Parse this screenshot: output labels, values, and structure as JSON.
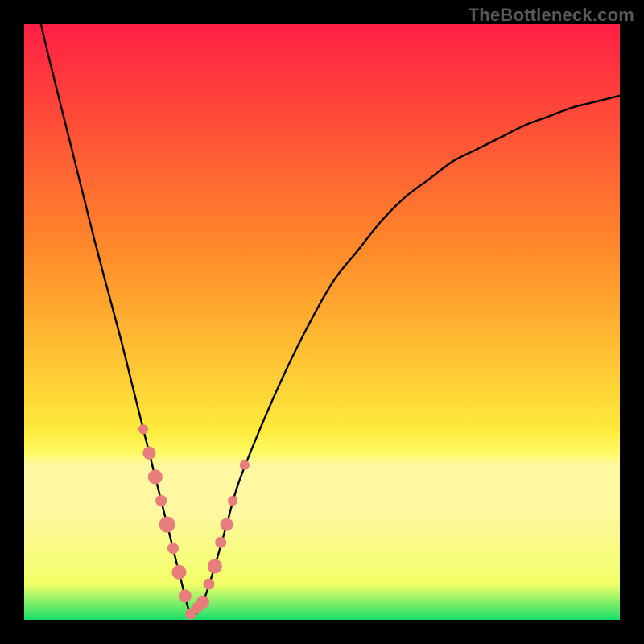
{
  "watermark": "TheBottleneck.com",
  "colors": {
    "bg": "#000000",
    "curve": "#000000",
    "marker": "#e77d7d",
    "grad_top": "#ff1f44",
    "grad_mid1": "#ff8a2a",
    "grad_mid2": "#ffe93b",
    "grad_band": "#fff8a0",
    "grad_bottom": "#18e06a"
  },
  "chart_data": {
    "type": "line",
    "title": "",
    "xlabel": "",
    "ylabel": "",
    "xlim": [
      0,
      100
    ],
    "ylim": [
      0,
      100
    ],
    "x_min_point": 28,
    "series": [
      {
        "name": "bottleneck-curve",
        "x": [
          0,
          4,
          8,
          12,
          16,
          18,
          20,
          22,
          24,
          26,
          28,
          30,
          32,
          34,
          36,
          40,
          44,
          48,
          52,
          56,
          60,
          64,
          68,
          72,
          76,
          80,
          84,
          88,
          92,
          96,
          100
        ],
        "y": [
          112,
          95,
          79,
          63,
          48,
          40,
          32,
          24,
          16,
          8,
          1,
          3,
          9,
          16,
          23,
          33,
          42,
          50,
          57,
          62,
          67,
          71,
          74,
          77,
          79,
          81,
          83,
          84.5,
          86,
          87,
          88
        ]
      }
    ],
    "markers": {
      "name": "highlighted-points",
      "x": [
        20,
        21,
        22,
        23,
        24,
        25,
        26,
        27,
        28,
        29,
        30,
        31,
        32,
        33,
        34,
        35,
        37
      ],
      "y": [
        32,
        28,
        24,
        20,
        16,
        12,
        8,
        4,
        1,
        2,
        3,
        6,
        9,
        13,
        16,
        20,
        26
      ],
      "r": [
        6,
        8,
        9,
        7,
        10,
        7,
        9,
        8,
        7,
        7,
        8,
        7,
        9,
        7,
        8,
        6,
        6
      ]
    }
  }
}
